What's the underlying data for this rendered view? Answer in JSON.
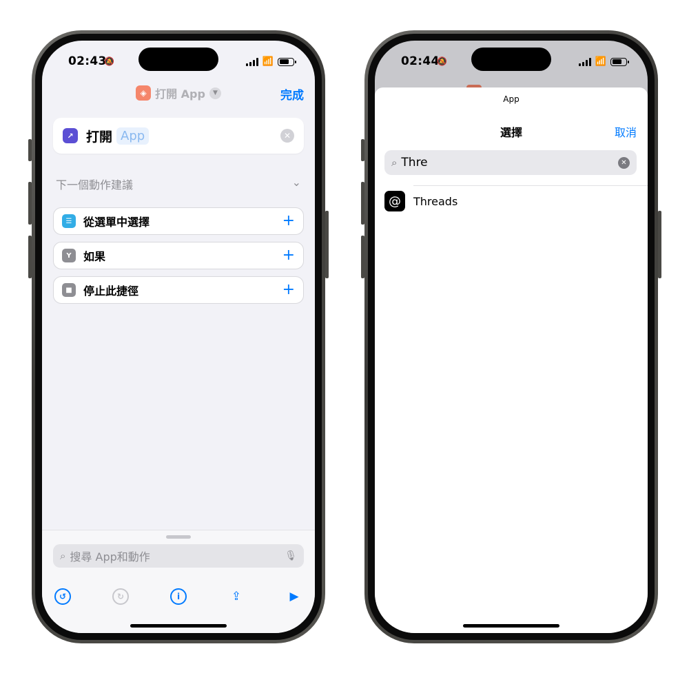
{
  "left_phone": {
    "status": {
      "time": "02:43"
    },
    "nav": {
      "title": "打開 App",
      "done_label": "完成"
    },
    "action": {
      "verb": "打開",
      "param": "App"
    },
    "suggestions": {
      "header": "下一個動作建議",
      "items": [
        {
          "label": "從選單中選擇",
          "color": "#32ade6"
        },
        {
          "label": "如果",
          "color": "#8e8e93"
        },
        {
          "label": "停止此捷徑",
          "color": "#8e8e93"
        }
      ]
    },
    "search": {
      "placeholder": "搜尋 App和動作"
    }
  },
  "right_phone": {
    "status": {
      "time": "02:44"
    },
    "sheet": {
      "subtitle": "App",
      "title": "選擇",
      "cancel_label": "取消"
    },
    "search": {
      "value": "Thre"
    },
    "results": [
      {
        "label": "Threads"
      }
    ]
  },
  "colors": {
    "accent": "#007aff",
    "shortcut_icon": "#f5866b",
    "open_app_icon": "#5b4fd4"
  }
}
